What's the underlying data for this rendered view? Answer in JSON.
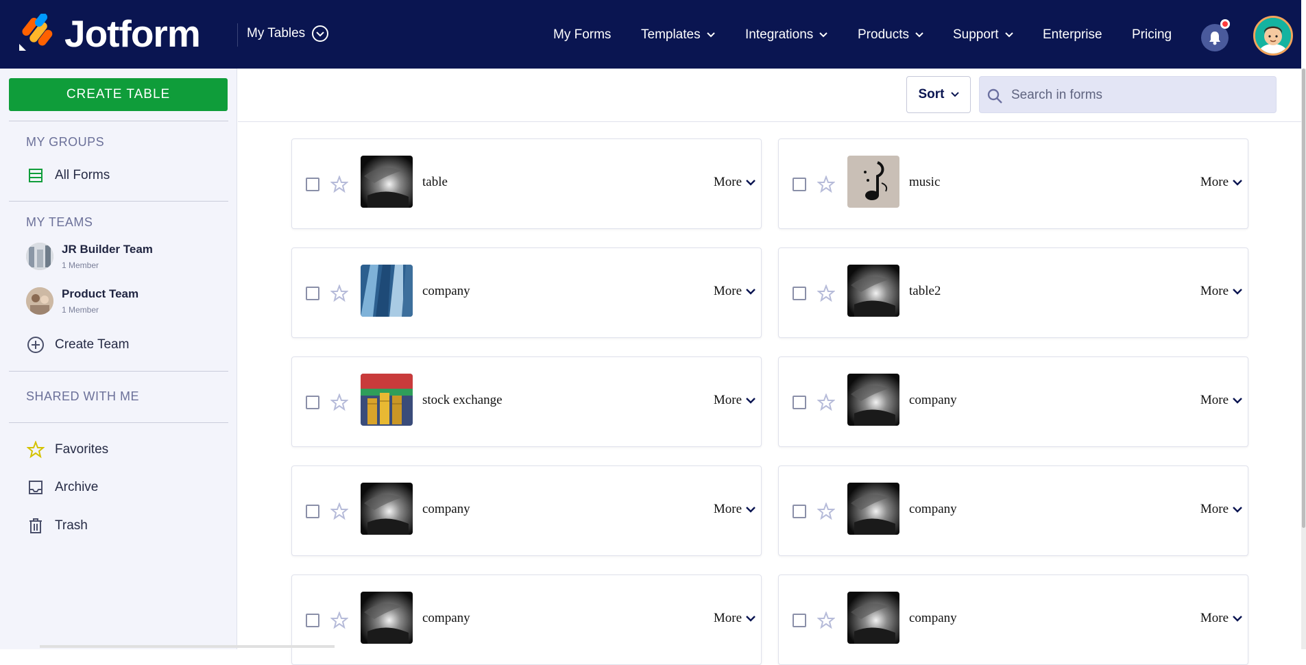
{
  "brand": {
    "name": "Jotform"
  },
  "app_selector": {
    "label": "My Tables"
  },
  "nav": {
    "items": [
      {
        "label": "My Forms",
        "has_dropdown": false
      },
      {
        "label": "Templates",
        "has_dropdown": true
      },
      {
        "label": "Integrations",
        "has_dropdown": true
      },
      {
        "label": "Products",
        "has_dropdown": true
      },
      {
        "label": "Support",
        "has_dropdown": true
      },
      {
        "label": "Enterprise",
        "has_dropdown": false
      },
      {
        "label": "Pricing",
        "has_dropdown": false
      }
    ]
  },
  "sidebar": {
    "create_button": "CREATE TABLE",
    "my_groups_title": "MY GROUPS",
    "all_forms": "All Forms",
    "my_teams_title": "MY TEAMS",
    "teams": [
      {
        "name": "JR Builder Team",
        "members": "1 Member"
      },
      {
        "name": "Product Team",
        "members": "1 Member"
      }
    ],
    "create_team": "Create Team",
    "shared_title": "SHARED WITH ME",
    "favorites": "Favorites",
    "archive": "Archive",
    "trash": "Trash"
  },
  "toolbar": {
    "sort_label": "Sort",
    "search_placeholder": "Search in forms"
  },
  "tables": [
    {
      "title": "table",
      "thumb": "dark-photo",
      "more": "More"
    },
    {
      "title": "music",
      "thumb": "music-note",
      "more": "More"
    },
    {
      "title": "company",
      "thumb": "blue-building",
      "more": "More"
    },
    {
      "title": "table2",
      "thumb": "dark-photo",
      "more": "More"
    },
    {
      "title": "stock exchange",
      "thumb": "coins",
      "more": "More"
    },
    {
      "title": "company",
      "thumb": "dark-photo",
      "more": "More"
    },
    {
      "title": "company",
      "thumb": "dark-photo",
      "more": "More"
    },
    {
      "title": "company",
      "thumb": "dark-photo",
      "more": "More"
    },
    {
      "title": "company",
      "thumb": "dark-photo",
      "more": "More"
    },
    {
      "title": "company",
      "thumb": "dark-photo",
      "more": "More"
    }
  ],
  "colors": {
    "nav_bg": "#0a1551",
    "create_button": "#0f9d3a",
    "sidebar_bg": "#f3f4fb",
    "search_bg": "#e3e5f5"
  }
}
